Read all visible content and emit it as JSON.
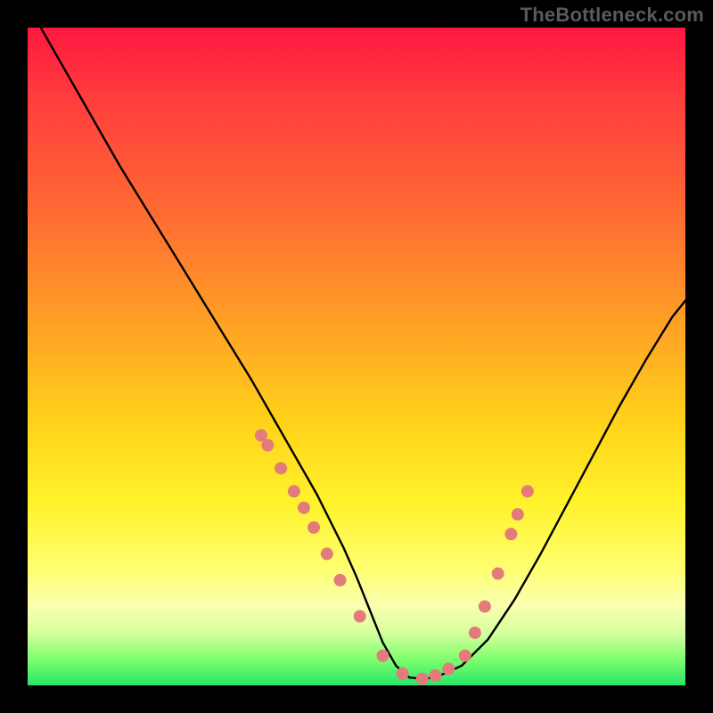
{
  "watermark": "TheBottleneck.com",
  "chart_data": {
    "type": "line",
    "title": "",
    "xlabel": "",
    "ylabel": "",
    "xlim": [
      0,
      100
    ],
    "ylim": [
      0,
      100
    ],
    "series": [
      {
        "name": "bottleneck-curve",
        "x": [
          2,
          6,
          10,
          14,
          18,
          22,
          26,
          30,
          34,
          36,
          38,
          40,
          42,
          44,
          46,
          48,
          50,
          52,
          54,
          56,
          58,
          60,
          62,
          66,
          70,
          74,
          78,
          82,
          86,
          90,
          94,
          98,
          100
        ],
        "values": [
          100,
          93,
          86,
          79,
          72.5,
          66,
          59.5,
          53,
          46.5,
          43,
          39.5,
          36,
          32.5,
          29,
          25,
          21,
          16.5,
          11.5,
          6.5,
          3,
          1.2,
          1,
          1.2,
          3,
          7,
          13,
          20,
          27.5,
          35,
          42.5,
          49.5,
          56,
          58.5
        ]
      }
    ],
    "markers": {
      "name": "sample-points",
      "color": "#e47b7b",
      "points": [
        {
          "x": 35.5,
          "y": 38
        },
        {
          "x": 36.5,
          "y": 36.5
        },
        {
          "x": 38.5,
          "y": 33.0
        },
        {
          "x": 40.5,
          "y": 29.5
        },
        {
          "x": 42.0,
          "y": 27.0
        },
        {
          "x": 43.5,
          "y": 24.0
        },
        {
          "x": 45.5,
          "y": 20.0
        },
        {
          "x": 47.5,
          "y": 16.0
        },
        {
          "x": 50.5,
          "y": 10.5
        },
        {
          "x": 54.0,
          "y": 4.5
        },
        {
          "x": 57.0,
          "y": 1.8
        },
        {
          "x": 60.0,
          "y": 1.0
        },
        {
          "x": 62.0,
          "y": 1.5
        },
        {
          "x": 64.0,
          "y": 2.5
        },
        {
          "x": 66.5,
          "y": 4.5
        },
        {
          "x": 68.0,
          "y": 8.0
        },
        {
          "x": 69.5,
          "y": 12.0
        },
        {
          "x": 71.5,
          "y": 17.0
        },
        {
          "x": 73.5,
          "y": 23.0
        },
        {
          "x": 74.5,
          "y": 26.0
        },
        {
          "x": 76.0,
          "y": 29.5
        }
      ]
    }
  }
}
